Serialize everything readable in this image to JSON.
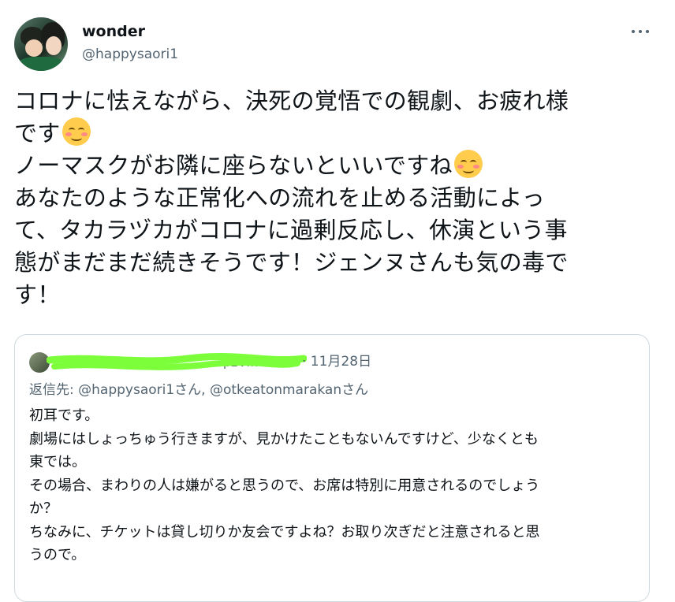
{
  "author": {
    "display_name": "wonder",
    "handle": "@happysaori1"
  },
  "tweet": {
    "lines": [
      "コロナに怯えながら、決死の覚悟での観劇、お疲れ様",
      "です",
      "ノーマスクがお隣に座らないといいですね",
      "あなたのような正常化への流れを止める活動によっ",
      "て、タカラヅカがコロナに過剰反応し、休演という事",
      "態がまだまだ続きそうです！ジェンヌさんも気の毒で",
      "す！"
    ],
    "emoji_names": [
      "smiling-face-with-blush-icon",
      "smiling-face-with-smiling-eyes-icon"
    ]
  },
  "quoted_tweet": {
    "name_partial": "p2Vfk",
    "date": "· 11月28日",
    "reply_to": "返信先: @happysaori1さん, @otkeatonmarakanさん",
    "lines": [
      "初耳です。",
      "劇場にはしょっちゅう行きますが、見かけたこともないんですけど、少なくとも",
      "東では。",
      "その場合、まわりの人は嫌がると思うので、お席は特別に用意されるのでしょう",
      "か？",
      "ちなみに、チケットは貸し切りか友会ですよね？お取り次ぎだと注意されると思",
      "うので。"
    ]
  },
  "colors": {
    "text": "#0f1419",
    "secondary": "#536471",
    "border": "#cfd9de",
    "redaction": "#7cff3a"
  }
}
